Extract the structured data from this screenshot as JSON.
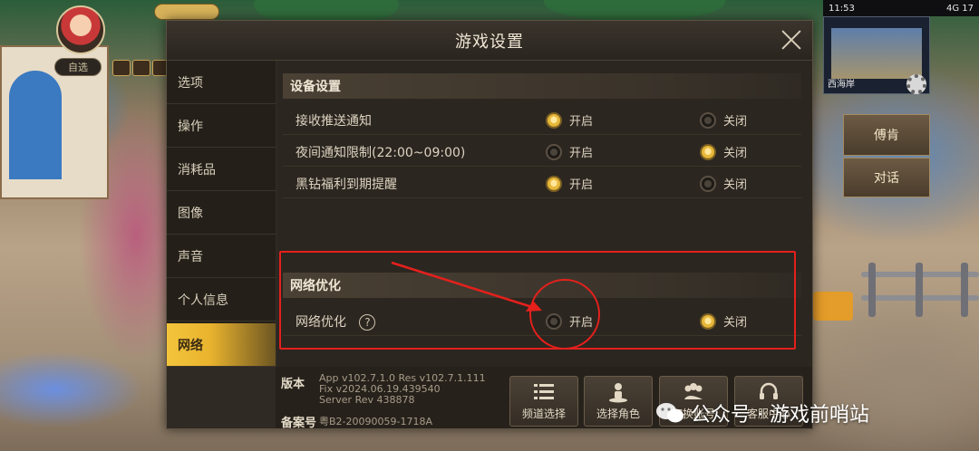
{
  "hud": {
    "pill_label": "自选"
  },
  "status_bar": {
    "time": "11:53",
    "signal": "4G 17"
  },
  "minimap": {
    "location": "西海岸"
  },
  "right_panel": {
    "btn1": "傅肯",
    "btn2": "对话"
  },
  "dialog": {
    "title": "游戏设置",
    "sidebar": [
      {
        "label": "选项",
        "active": false
      },
      {
        "label": "操作",
        "active": false
      },
      {
        "label": "消耗品",
        "active": false
      },
      {
        "label": "图像",
        "active": false
      },
      {
        "label": "声音",
        "active": false
      },
      {
        "label": "个人信息",
        "active": false
      },
      {
        "label": "网络",
        "active": true
      }
    ],
    "device_section": {
      "title": "设备设置",
      "rows": [
        {
          "label": "接收推送通知",
          "on_label": "开启",
          "off_label": "关闭",
          "selected": "on"
        },
        {
          "label": "夜间通知限制(22:00~09:00)",
          "on_label": "开启",
          "off_label": "关闭",
          "selected": "off"
        },
        {
          "label": "黑钻福利到期提醒",
          "on_label": "开启",
          "off_label": "关闭",
          "selected": "on"
        }
      ]
    },
    "network_section": {
      "title": "网络优化",
      "row": {
        "label": "网络优化",
        "help": "?",
        "on_label": "开启",
        "off_label": "关闭",
        "selected": "off"
      }
    },
    "footer": {
      "version_label": "版本",
      "version_lines": [
        "App v102.7.1.0 Res v102.7.1.111",
        "Fix v2024.06.19.439540",
        "Server Rev 438878"
      ],
      "registration_label": "备案号",
      "registration_value": "粤B2-20090059-1718A",
      "buttons": [
        {
          "label": "频道选择",
          "icon": "list-icon"
        },
        {
          "label": "选择角色",
          "icon": "character-icon"
        },
        {
          "label": "切换账号",
          "icon": "users-icon"
        },
        {
          "label": "客服中心",
          "icon": "headset-icon"
        }
      ]
    }
  },
  "watermark": {
    "text": "公众号 · 游戏前哨站"
  }
}
